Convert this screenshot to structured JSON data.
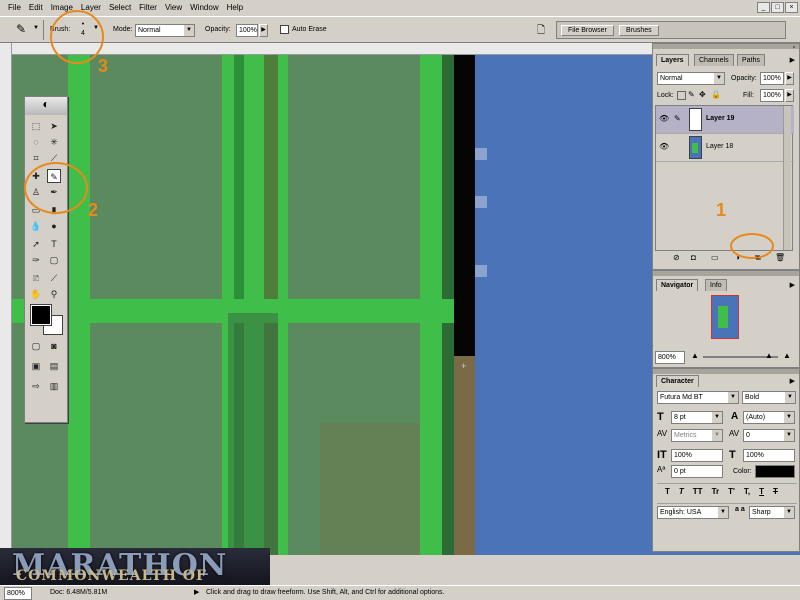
{
  "menu": [
    "File",
    "Edit",
    "Image",
    "Layer",
    "Select",
    "Filter",
    "View",
    "Window",
    "Help"
  ],
  "window_controls": [
    "_",
    "□",
    "×"
  ],
  "options": {
    "brush_label": "Brush:",
    "brush_size": "4",
    "mode_label": "Mode:",
    "mode_value": "Normal",
    "opacity_label": "Opacity:",
    "opacity_value": "100%",
    "auto_erase": "Auto Erase",
    "file_browser_tab": "File Browser",
    "brushes_tab": "Brushes"
  },
  "layers_panel": {
    "tabs": [
      "Layers",
      "Channels",
      "Paths"
    ],
    "blend_mode": "Normal",
    "opacity_label": "Opacity:",
    "opacity_value": "100%",
    "lock_label": "Lock:",
    "fill_label": "Fill:",
    "fill_value": "100%",
    "layers": [
      {
        "name": "Layer 19",
        "selected": true
      },
      {
        "name": "Layer 18",
        "selected": false
      }
    ]
  },
  "navigator_panel": {
    "tabs": [
      "Navigator",
      "Info"
    ],
    "zoom": "800%"
  },
  "character_panel": {
    "title": "Character",
    "font_family": "Futura Md BT",
    "font_style": "Bold",
    "size": "8 pt",
    "leading": "(Auto)",
    "kerning": "Metrics",
    "tracking": "0",
    "vertical_scale": "100%",
    "horizontal_scale": "100%",
    "baseline_shift": "0 pt",
    "color_label": "Color:",
    "style_buttons": [
      "T",
      "T",
      "TT",
      "Tr",
      "T'",
      "T,",
      "T",
      "T"
    ],
    "language": "English: USA",
    "antialias_label": "a a",
    "antialias": "Sharp"
  },
  "status_bar": {
    "zoom": "800%",
    "doc": "Doc: 6.48M/5.81M",
    "hint": "Click and drag to draw freeform. Use Shift, Alt, and Ctrl for additional options."
  },
  "watermark": {
    "line1": "MARATHON",
    "line2": "COMMONWEALTH OF"
  },
  "callouts": [
    "1",
    "2",
    "3"
  ],
  "colors": {
    "canvas_blue": "#4a73b8",
    "green_bright": "#3fbf49",
    "green_dark": "#5a8a5e",
    "callout_orange": "#e8891c"
  }
}
